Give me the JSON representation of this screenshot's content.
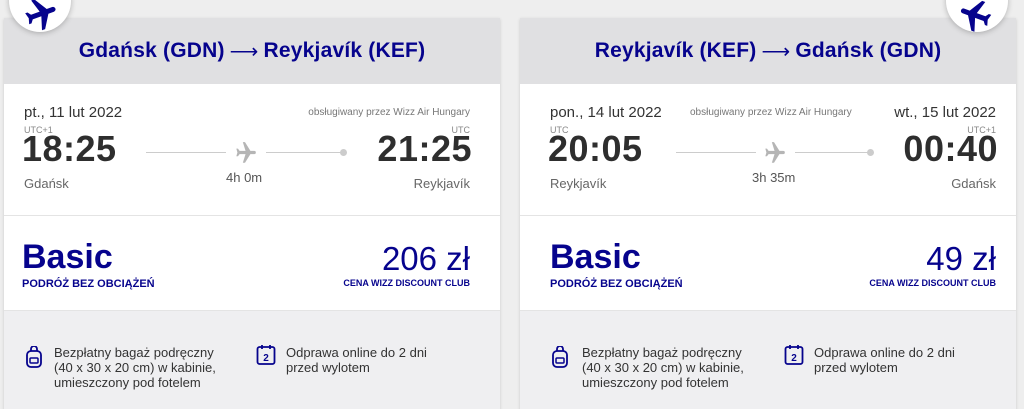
{
  "outbound": {
    "route": {
      "from": "Gdańsk (GDN)",
      "arrow": "⟶",
      "to": "Reykjavík (KEF)"
    },
    "departure": {
      "date": "pt., 11 lut 2022",
      "tz": "UTC+1",
      "time": "18:25",
      "city": "Gdańsk"
    },
    "arrival": {
      "date": "",
      "tz": "UTC",
      "time": "21:25",
      "city": "Reykjavík"
    },
    "operator": "obsługiwany przez Wizz Air Hungary",
    "duration": "4h 0m",
    "fare": {
      "name": "Basic",
      "subtitle": "PODRÓŻ BEZ OBCIĄŻEŃ",
      "price": "206 zł",
      "price_note": "CENA WIZZ DISCOUNT CLUB"
    },
    "benefits": [
      {
        "icon": "backpack-icon",
        "text_lines": [
          "Bezpłatny bagaż podręczny",
          "(40 x 30 x 20 cm) w kabinie,",
          "umieszczony pod fotelem"
        ]
      },
      {
        "icon": "calendar-2-icon",
        "text_lines": [
          "Odprawa online do 2 dni",
          "przed wylotem"
        ]
      }
    ]
  },
  "return": {
    "route": {
      "from": "Reykjavík (KEF)",
      "arrow": "⟶",
      "to": "Gdańsk (GDN)"
    },
    "departure": {
      "date": "pon., 14 lut 2022",
      "tz": "UTC",
      "time": "20:05",
      "city": "Reykjavík"
    },
    "arrival": {
      "date": "wt., 15 lut 2022",
      "tz": "UTC+1",
      "time": "00:40",
      "city": "Gdańsk"
    },
    "operator": "obsługiwany przez Wizz Air Hungary",
    "duration": "3h 35m",
    "fare": {
      "name": "Basic",
      "subtitle": "PODRÓŻ BEZ OBCIĄŻEŃ",
      "price": "49 zł",
      "price_note": "CENA WIZZ DISCOUNT CLUB"
    },
    "benefits": [
      {
        "icon": "backpack-icon",
        "text_lines": [
          "Bezpłatny bagaż podręczny",
          "(40 x 30 x 20 cm) w kabinie,",
          "umieszczony pod fotelem"
        ]
      },
      {
        "icon": "calendar-2-icon",
        "text_lines": [
          "Odprawa online do 2 dni",
          "przed wylotem"
        ]
      }
    ]
  },
  "icons": {
    "badge": "airplane-icon",
    "route": "airplane-gray-icon"
  },
  "colors": {
    "brand": "#06038d",
    "header_bg": "#e0e0e2",
    "benefits_bg": "#efeff1"
  }
}
